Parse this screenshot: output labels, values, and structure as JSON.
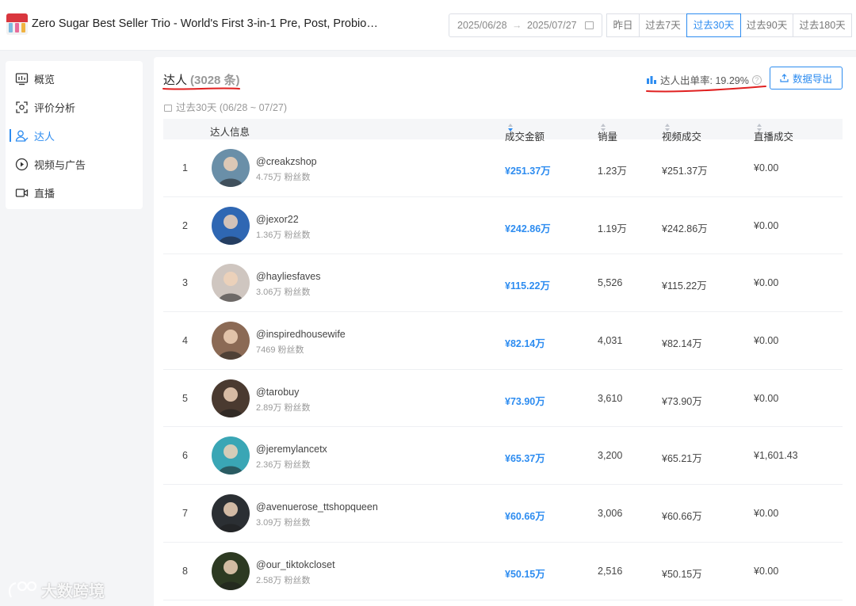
{
  "header": {
    "product_title": "Zero Sugar Best Seller Trio - World's First 3-in-1 Pre, Post, Probioti...",
    "date_start": "2025/06/28",
    "date_end": "2025/07/27",
    "date_arrow": "→",
    "ranges": [
      {
        "label": "昨日",
        "active": false
      },
      {
        "label": "过去7天",
        "active": false
      },
      {
        "label": "过去30天",
        "active": true
      },
      {
        "label": "过去90天",
        "active": false
      },
      {
        "label": "过去180天",
        "active": false
      }
    ]
  },
  "sidebar": {
    "items": [
      {
        "label": "概览",
        "icon": "overview-chart-icon",
        "active": false
      },
      {
        "label": "评价分析",
        "icon": "review-analysis-icon",
        "active": false
      },
      {
        "label": "达人",
        "icon": "creator-users-icon",
        "active": true
      },
      {
        "label": "视频与广告",
        "icon": "video-play-icon",
        "active": false
      },
      {
        "label": "直播",
        "icon": "live-camera-icon",
        "active": false
      }
    ]
  },
  "main": {
    "title": "达人",
    "count": "(3028 条)",
    "sub_range": "过去30天 (06/28 ~ 07/27)",
    "rate_label": "达人出单率: 19.29%",
    "export_label": "数据导出",
    "columns": {
      "info": "达人信息",
      "gmv": "成交金额",
      "sales": "销量",
      "video": "视频成交",
      "live": "直播成交"
    },
    "rows": [
      {
        "rank": "1",
        "name": "@creakzshop",
        "fans": "4.75万 粉丝数",
        "gmv": "¥251.37万",
        "sales": "1.23万",
        "video": "¥251.37万",
        "live": "¥0.00",
        "avatar_color": "#6a8fa8"
      },
      {
        "rank": "2",
        "name": "@jexor22",
        "fans": "1.36万 粉丝数",
        "gmv": "¥242.86万",
        "sales": "1.19万",
        "video": "¥242.86万",
        "live": "¥0.00",
        "avatar_color": "#2f67b3"
      },
      {
        "rank": "3",
        "name": "@hayliesfaves",
        "fans": "3.06万 粉丝数",
        "gmv": "¥115.22万",
        "sales": "5,526",
        "video": "¥115.22万",
        "live": "¥0.00",
        "avatar_color": "#cfc6c0"
      },
      {
        "rank": "4",
        "name": "@inspiredhousewife",
        "fans": "7469 粉丝数",
        "gmv": "¥82.14万",
        "sales": "4,031",
        "video": "¥82.14万",
        "live": "¥0.00",
        "avatar_color": "#8b6a55"
      },
      {
        "rank": "5",
        "name": "@tarobuy",
        "fans": "2.89万 粉丝数",
        "gmv": "¥73.90万",
        "sales": "3,610",
        "video": "¥73.90万",
        "live": "¥0.00",
        "avatar_color": "#4a3a30"
      },
      {
        "rank": "6",
        "name": "@jeremylancetx",
        "fans": "2.36万 粉丝数",
        "gmv": "¥65.37万",
        "sales": "3,200",
        "video": "¥65.21万",
        "live": "¥1,601.43",
        "avatar_color": "#3aa6b5"
      },
      {
        "rank": "7",
        "name": "@avenuerose_ttshopqueen",
        "fans": "3.09万 粉丝数",
        "gmv": "¥60.66万",
        "sales": "3,006",
        "video": "¥60.66万",
        "live": "¥0.00",
        "avatar_color": "#2b2f33"
      },
      {
        "rank": "8",
        "name": "@our_tiktokcloset",
        "fans": "2.58万 粉丝数",
        "gmv": "¥50.15万",
        "sales": "2,516",
        "video": "¥50.15万",
        "live": "¥0.00",
        "avatar_color": "#2d3a22"
      }
    ]
  },
  "watermark": "大数跨境",
  "colors": {
    "accent": "#2d8cf0",
    "annotation_red": "#e02020"
  }
}
